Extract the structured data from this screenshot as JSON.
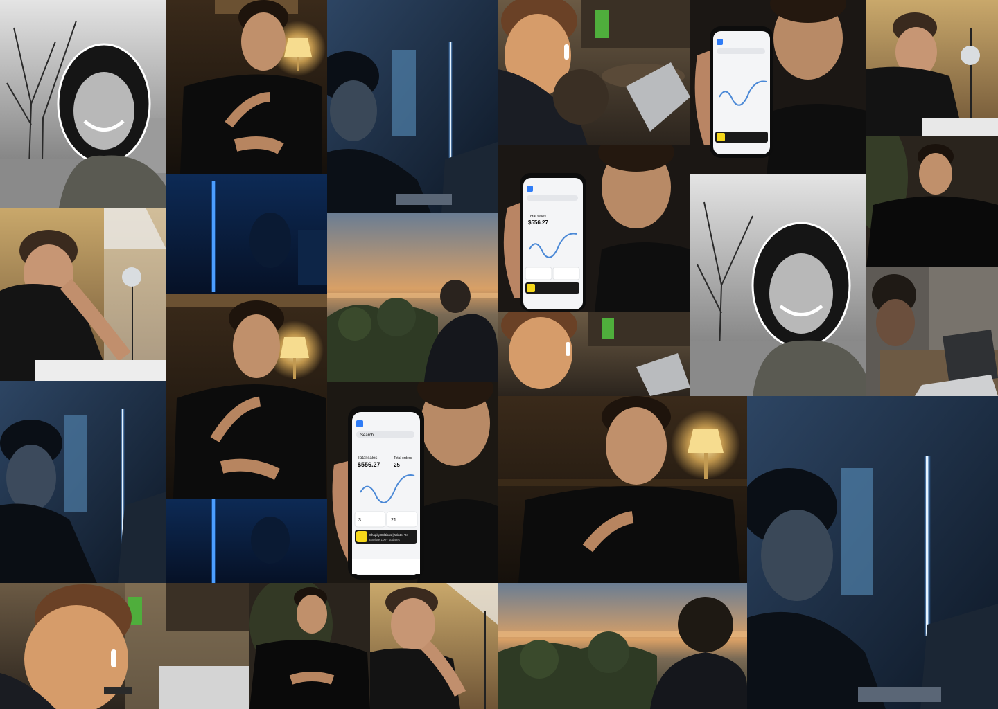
{
  "collage": {
    "phone": {
      "search": "Search",
      "total_sales_label": "Total sales",
      "total_sales_value": "$556.27",
      "total_orders_label": "Total orders",
      "orders_value": "25",
      "sessions_value": "3",
      "points_value": "21",
      "banner_title": "Shopify Editions | Winter '24",
      "banner_sub": "Explore 100+ updates"
    }
  }
}
